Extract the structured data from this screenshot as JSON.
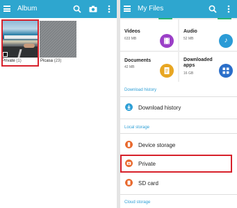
{
  "album": {
    "title": "Album",
    "albums": [
      {
        "name": "Private",
        "count": "(1)"
      },
      {
        "name": "Picasa",
        "count": "(23)"
      }
    ],
    "icons": [
      "menu-icon",
      "search-icon",
      "camera-icon",
      "more-vert-icon"
    ]
  },
  "files": {
    "title": "My Files",
    "categories": [
      {
        "name": "Videos",
        "size": "633 MB",
        "color": "#9b3fc7",
        "icon": "video-icon"
      },
      {
        "name": "Audio",
        "size": "52 MB",
        "color": "#2b9bd6",
        "icon": "music-icon"
      },
      {
        "name": "Documents",
        "size": "42 MB",
        "color": "#e8a622",
        "icon": "document-icon"
      },
      {
        "name": "Downloaded apps",
        "size": "16 GB",
        "color": "#2a6ec9",
        "icon": "apps-icon"
      }
    ],
    "download_history_header": "Download history",
    "download_history_item": "Download history",
    "local_storage_header": "Local storage",
    "device_storage": "Device storage",
    "private": "Private",
    "sd_card": "SD card",
    "cloud_storage_header": "Cloud storage"
  },
  "colors": {
    "appbar": "#2ea6cf",
    "section_label": "#2e9fd6",
    "highlight": "#d7212b",
    "storage_icon": "#e8672b"
  }
}
